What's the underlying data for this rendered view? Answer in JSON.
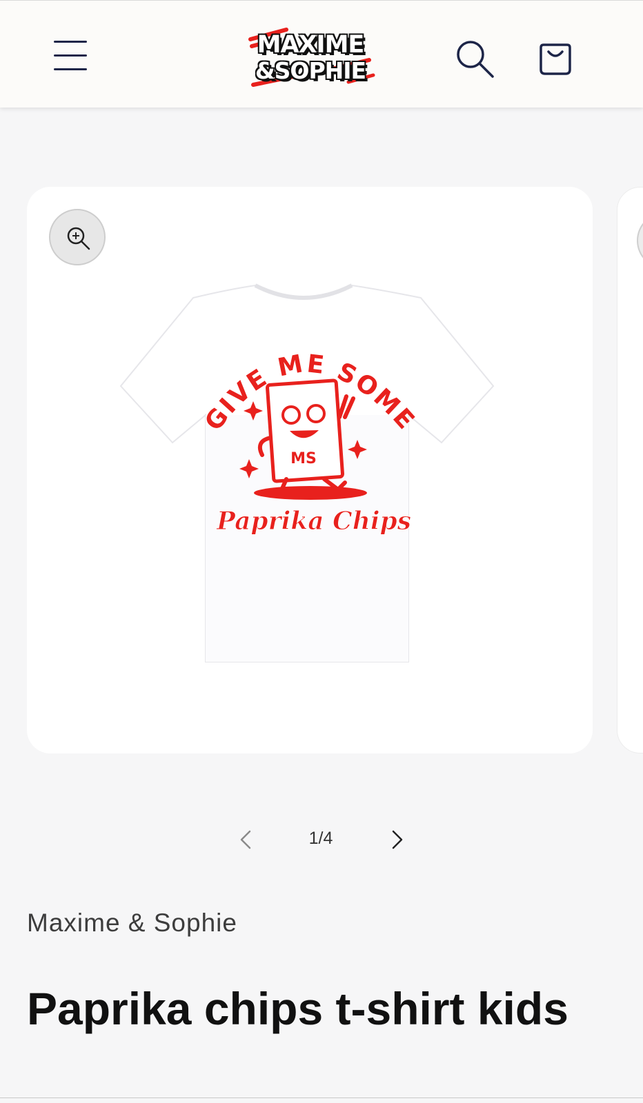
{
  "header": {
    "logo_line1": "MAXIME",
    "logo_line2": "&SOPHIE",
    "menu_icon": "hamburger-icon",
    "search_icon": "search-icon",
    "cart_icon": "cart-bag-icon"
  },
  "gallery": {
    "zoom_icon": "zoom-in-icon",
    "print_top_text": "GIVE ME SOME",
    "print_badge": "MS",
    "print_bottom_text": "Paprika Chips",
    "print_color": "#e8211d",
    "pager": {
      "current": "1/4",
      "prev_icon": "chevron-left-icon",
      "next_icon": "chevron-right-icon"
    }
  },
  "product": {
    "vendor": "Maxime & Sophie",
    "title": "Paprika chips t-shirt kids"
  },
  "colors": {
    "header_bg": "#fcfbf9",
    "page_bg": "#f6f6f7",
    "icon_navy": "#1d2548",
    "accent_red": "#e8211d"
  }
}
